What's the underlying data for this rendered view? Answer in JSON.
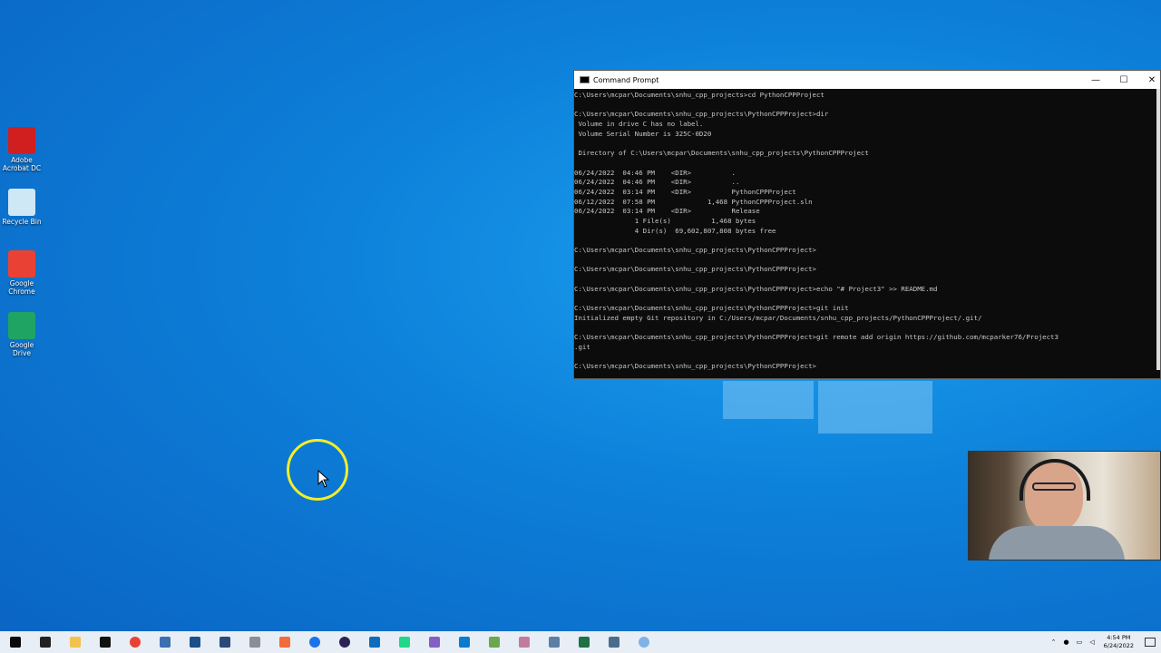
{
  "desktop": {
    "icons": [
      {
        "label": "Adobe Acrobat DC",
        "icon": "adobe-acrobat-icon",
        "color": "#d11f1f"
      },
      {
        "label": "Recycle Bin",
        "icon": "recycle-bin-icon",
        "color": "#cfe8f6"
      },
      {
        "label": "Google Chrome",
        "icon": "chrome-icon",
        "color": "#e94235"
      },
      {
        "label": "Google Drive",
        "icon": "google-drive-icon",
        "color": "#1fa463"
      }
    ]
  },
  "cmd": {
    "title": "Command Prompt",
    "minimize": "—",
    "maximize": "☐",
    "close": "✕",
    "lines": [
      "C:\\Users\\mcpar\\Documents\\snhu_cpp_projects>cd PythonCPPProject",
      "",
      "C:\\Users\\mcpar\\Documents\\snhu_cpp_projects\\PythonCPPProject>dir",
      " Volume in drive C has no label.",
      " Volume Serial Number is 325C-0D20",
      "",
      " Directory of C:\\Users\\mcpar\\Documents\\snhu_cpp_projects\\PythonCPPProject",
      "",
      "06/24/2022  04:46 PM    <DIR>          .",
      "06/24/2022  04:46 PM    <DIR>          ..",
      "06/24/2022  03:14 PM    <DIR>          PythonCPPProject",
      "06/12/2022  07:58 PM             1,468 PythonCPPProject.sln",
      "06/24/2022  03:14 PM    <DIR>          Release",
      "               1 File(s)          1,468 bytes",
      "               4 Dir(s)  69,602,807,808 bytes free",
      "",
      "C:\\Users\\mcpar\\Documents\\snhu_cpp_projects\\PythonCPPProject>",
      "",
      "C:\\Users\\mcpar\\Documents\\snhu_cpp_projects\\PythonCPPProject>",
      "",
      "C:\\Users\\mcpar\\Documents\\snhu_cpp_projects\\PythonCPPProject>echo \"# Project3\" >> README.md",
      "",
      "C:\\Users\\mcpar\\Documents\\snhu_cpp_projects\\PythonCPPProject>git init",
      "Initialized empty Git repository in C:/Users/mcpar/Documents/snhu_cpp_projects/PythonCPPProject/.git/",
      "",
      "C:\\Users\\mcpar\\Documents\\snhu_cpp_projects\\PythonCPPProject>git remote add origin https://github.com/mcparker76/Project3",
      ".git",
      "",
      "C:\\Users\\mcpar\\Documents\\snhu_cpp_projects\\PythonCPPProject>"
    ]
  },
  "taskbar": {
    "apps": [
      {
        "name": "start-icon",
        "color": "#0b0b0b"
      },
      {
        "name": "search-icon",
        "color": "#222222"
      },
      {
        "name": "file-explorer-icon",
        "color": "#f2c14e"
      },
      {
        "name": "cmd-icon",
        "color": "#111111"
      },
      {
        "name": "chrome-icon",
        "color": "#e94235"
      },
      {
        "name": "app-icon-1",
        "color": "#3c6fb0"
      },
      {
        "name": "virtualbox-icon",
        "color": "#1b4f8a"
      },
      {
        "name": "app-icon-2",
        "color": "#2a4a7a"
      },
      {
        "name": "database-icon",
        "color": "#8a8f96"
      },
      {
        "name": "postman-icon",
        "color": "#f26b3a"
      },
      {
        "name": "maps-icon",
        "color": "#1a73e8"
      },
      {
        "name": "eclipse-icon",
        "color": "#2c2255"
      },
      {
        "name": "outlook-icon",
        "color": "#0f6cbd"
      },
      {
        "name": "pycharm-icon",
        "color": "#21d789"
      },
      {
        "name": "visual-studio-icon",
        "color": "#865fc5"
      },
      {
        "name": "vscode-icon",
        "color": "#0b7bd0"
      },
      {
        "name": "app-icon-3",
        "color": "#6aa84f"
      },
      {
        "name": "snipping-icon",
        "color": "#c27ba0"
      },
      {
        "name": "calculator-icon",
        "color": "#5b7fa6"
      },
      {
        "name": "excel-icon",
        "color": "#1e7145"
      },
      {
        "name": "app-icon-4",
        "color": "#4a6d8c"
      },
      {
        "name": "record-icon",
        "color": "#7fb3e6"
      }
    ],
    "time": "4:54 PM",
    "date": "6/24/2022"
  }
}
